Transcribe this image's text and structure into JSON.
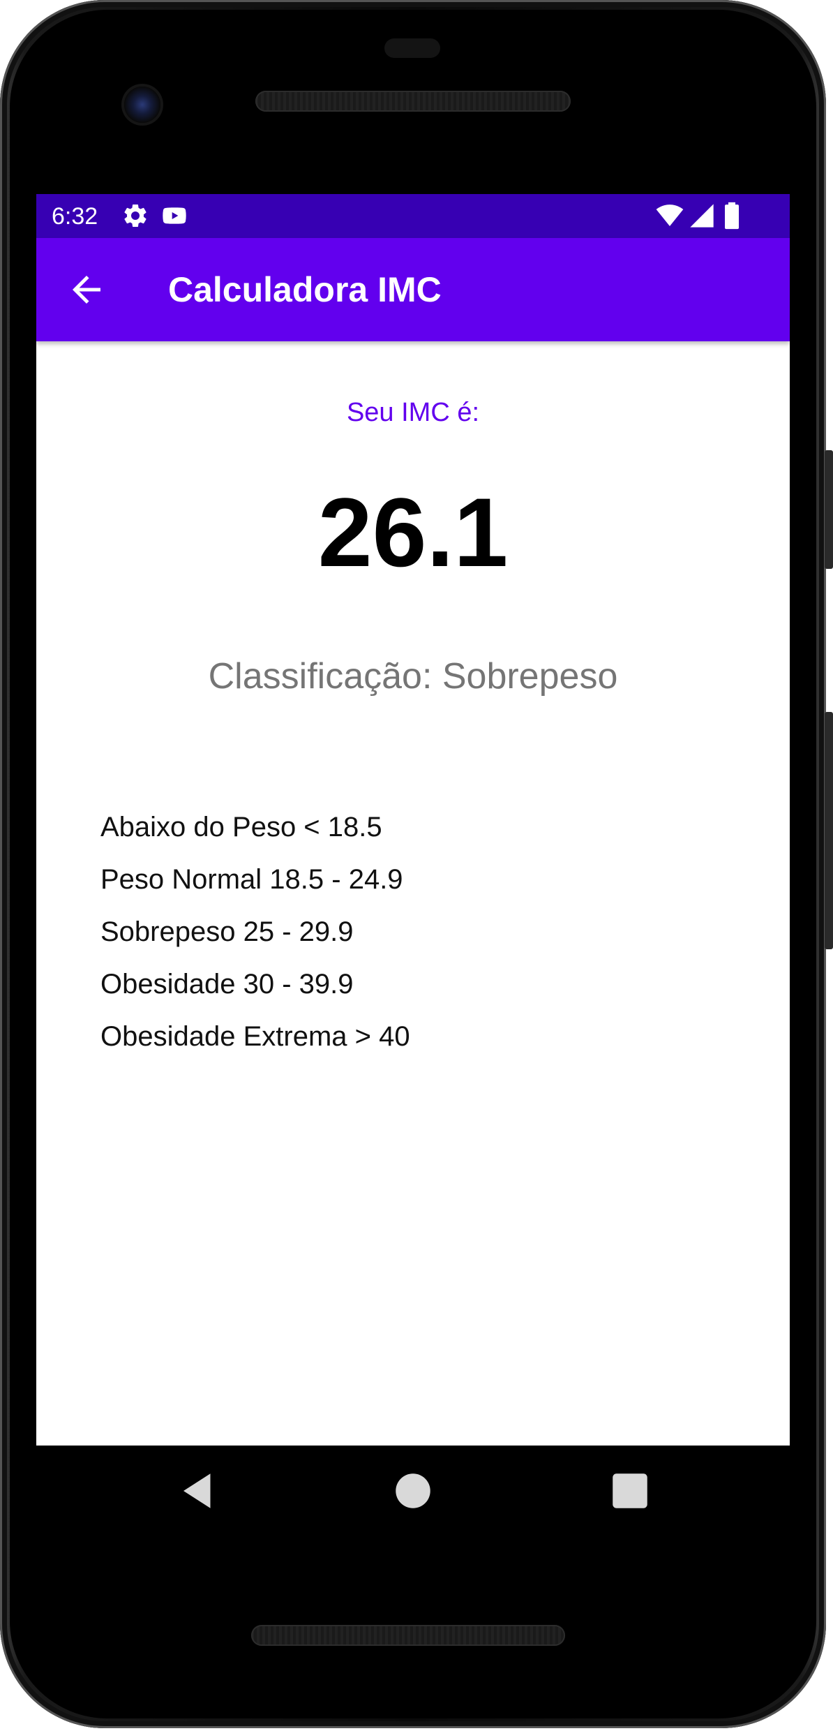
{
  "status_bar": {
    "time": "6:32",
    "background_color": "#3700b3",
    "left_icons": [
      "settings-gear-icon",
      "youtube-icon"
    ],
    "right_icons": [
      "wifi-icon",
      "cell-signal-icon",
      "battery-icon"
    ]
  },
  "app_bar": {
    "title": "Calculadora IMC",
    "background_color": "#6200ee",
    "navigation_icon": "arrow-back-icon"
  },
  "result": {
    "label": "Seu IMC é:",
    "label_color": "#6200ee",
    "value": "26.1",
    "classification": "Classificação: Sobrepeso",
    "classification_color": "#757575"
  },
  "ranges": [
    {
      "text": "Abaixo do Peso < 18.5"
    },
    {
      "text": "Peso Normal 18.5 - 24.9"
    },
    {
      "text": "Sobrepeso 25 - 29.9"
    },
    {
      "text": "Obesidade 30 - 39.9"
    },
    {
      "text": "Obesidade Extrema > 40"
    }
  ],
  "system_nav": {
    "buttons": [
      "back-triangle-icon",
      "home-circle-icon",
      "recents-square-icon"
    ]
  }
}
